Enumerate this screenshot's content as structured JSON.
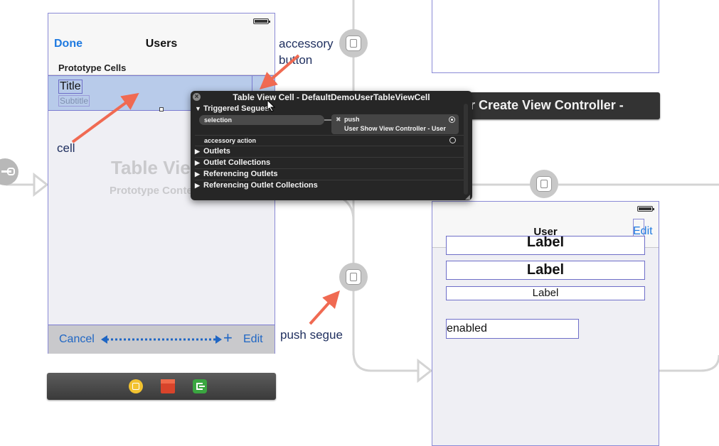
{
  "left_scene": {
    "nav": {
      "done_label": "Done",
      "title": "Users"
    },
    "section_header": "Prototype Cells",
    "cell": {
      "title": "Title",
      "subtitle": "Subtitle"
    },
    "placeholder": {
      "title": "Table View",
      "subtitle": "Prototype Content"
    },
    "toolbar": {
      "cancel_label": "Cancel",
      "edit_label": "Edit"
    }
  },
  "annotations": {
    "accessory_line1": "accessory",
    "accessory_line2": "button",
    "cell": "cell",
    "push_segue": "push segue"
  },
  "popup": {
    "title": "Table View Cell - DefaultDemoUserTableViewCell",
    "triggered_segues": "Triggered Segues",
    "selection_label": "selection",
    "segue_type": "push",
    "segue_destination": "User Show View Controller - User",
    "accessory_action": "accessory action",
    "sections": [
      "Outlets",
      "Outlet Collections",
      "Referencing Outlets",
      "Referencing Outlet Collections"
    ]
  },
  "right_scenes": {
    "vc_bar_title": "User Create View Controller -",
    "user_nav": {
      "title": "User",
      "edit_label": "Edit"
    },
    "labels": [
      "Label",
      "Label",
      "Label"
    ],
    "enabled_field": "enabled"
  },
  "colors": {
    "accent_blue": "#1f7ae0",
    "annotation_arrow": "#f06a52",
    "selection_highlight": "#b8cbea",
    "popup_bg": "#262626"
  },
  "icons": {
    "dock": [
      "view-controller-icon",
      "first-responder-cube-icon",
      "exit-icon"
    ],
    "segue": "segue-icon"
  }
}
